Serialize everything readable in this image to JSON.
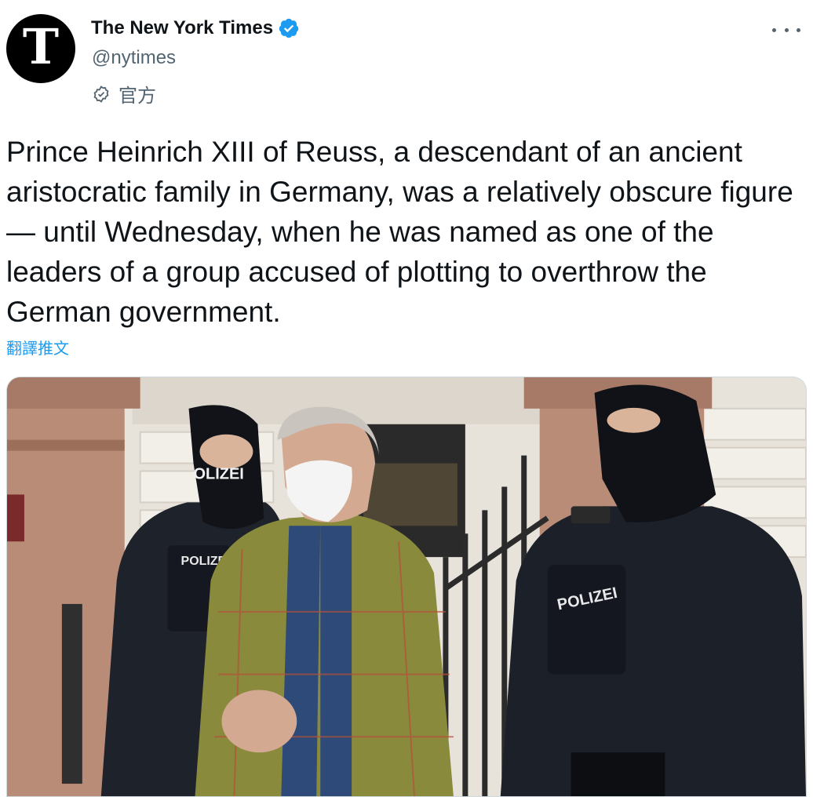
{
  "account": {
    "name": "The New York Times",
    "handle": "@nytimes",
    "label": "官方",
    "avatar_letter": "T"
  },
  "tweet": {
    "text": "Prince Heinrich XIII of Reuss, a descendant of an ancient aristocratic family in Germany, was a relatively obscure figure — until Wednesday, when he was named as one of the leaders of a group accused of plotting to overthrow the German government.",
    "translate_label": "翻譯推文"
  },
  "photo": {
    "vest_label_left": "POLIZEI",
    "vest_label_right": "POLIZEI",
    "mask_label": "OLIZEI"
  },
  "colors": {
    "verified": "#1d9bf0",
    "link": "#1d9bf0",
    "secondary_text": "#536471"
  },
  "icons": [
    "verified-badge-icon",
    "official-label-icon",
    "more-options-icon"
  ]
}
